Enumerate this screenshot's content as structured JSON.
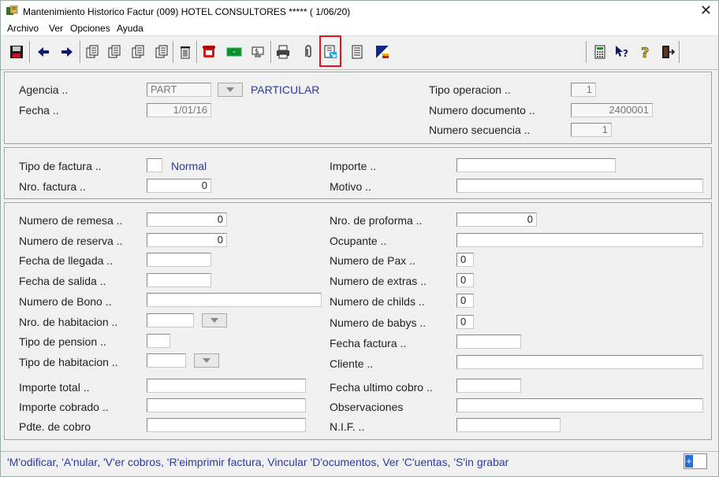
{
  "window": {
    "title": "Mantenimiento Historico Factur  (009) HOTEL CONSULTORES *****      ( 1/06/20)",
    "close_glyph": "✕"
  },
  "menu": [
    "Archivo",
    "Ver",
    "Opciones",
    "Ayuda"
  ],
  "toolbar": {
    "icons": [
      "save-icon",
      "back-arrow-icon",
      "forward-arrow-icon",
      "copy-doc-icon-1",
      "copy-doc-icon-2",
      "copy-doc-icon-3",
      "copy-doc-icon-4",
      "trash-icon",
      "phone-icon",
      "money-icon",
      "cash-icon",
      "printer-icon",
      "paperclip-icon",
      "document-arrow-icon",
      "form-icon",
      "flag-icon",
      "calculator-icon",
      "context-help-icon",
      "help-icon",
      "exit-door-icon"
    ],
    "highlighted": "document-arrow-icon"
  },
  "header": {
    "agencia_label": "Agencia ..",
    "agencia_value": "PART",
    "agencia_name": "PARTICULAR",
    "fecha_label": "Fecha ..",
    "fecha_value": "1/01/16",
    "tipo_operacion_label": "Tipo operacion ..",
    "tipo_operacion_value": "1",
    "numero_documento_label": "Numero documento ..",
    "numero_documento_value": "2400001",
    "numero_secuencia_label": "Numero secuencia ..",
    "numero_secuencia_value": "1"
  },
  "factura": {
    "tipo_label": "Tipo de factura ..",
    "tipo_value": "",
    "tipo_name": "Normal",
    "nro_label": "Nro. factura ..",
    "nro_value": "0",
    "importe_label": "Importe ..",
    "importe_value": "",
    "motivo_label": "Motivo ..",
    "motivo_value": ""
  },
  "details": {
    "left": [
      {
        "label": "Numero de remesa ..",
        "value": "0"
      },
      {
        "label": "Numero de reserva ..",
        "value": "0"
      },
      {
        "label": "Fecha de llegada ..",
        "value": ""
      },
      {
        "label": "Fecha de salida ..",
        "value": ""
      },
      {
        "label": "Numero de Bono ..",
        "value": ""
      },
      {
        "label": "Nro. de habitacion ..",
        "value": ""
      },
      {
        "label": "Tipo de pension ..",
        "value": ""
      },
      {
        "label": "Tipo de habitacion ..",
        "value": ""
      }
    ],
    "right": [
      {
        "label": "Nro. de proforma ..",
        "value": "0"
      },
      {
        "label": "Ocupante ..",
        "value": ""
      },
      {
        "label": "Numero de Pax ..",
        "value": "0"
      },
      {
        "label": "Numero de extras ..",
        "value": "0"
      },
      {
        "label": "Numero de childs ..",
        "value": "0"
      },
      {
        "label": "Numero de babys ..",
        "value": "0"
      },
      {
        "label": "Fecha factura ..",
        "value": ""
      },
      {
        "label": "Cliente ..",
        "value": ""
      }
    ],
    "bottom_left": [
      {
        "label": "Importe total ..",
        "value": ""
      },
      {
        "label": "Importe cobrado ..",
        "value": ""
      },
      {
        "label": "Pdte. de cobro",
        "value": ""
      }
    ],
    "bottom_right": [
      {
        "label": "Fecha ultimo cobro ..",
        "value": ""
      },
      {
        "label": "Observaciones",
        "value": ""
      },
      {
        "label": "N.I.F. ..",
        "value": ""
      }
    ]
  },
  "status": {
    "text": "'M'odificar, 'A'nular, 'V'er cobros, 'R'eimprimir factura, Vincular 'D'ocumentos, Ver 'C'uentas, 'S'in grabar",
    "indicator": "+"
  },
  "colors": {
    "accent_blue": "#2a3a9c",
    "highlight_red": "#e0141e"
  }
}
